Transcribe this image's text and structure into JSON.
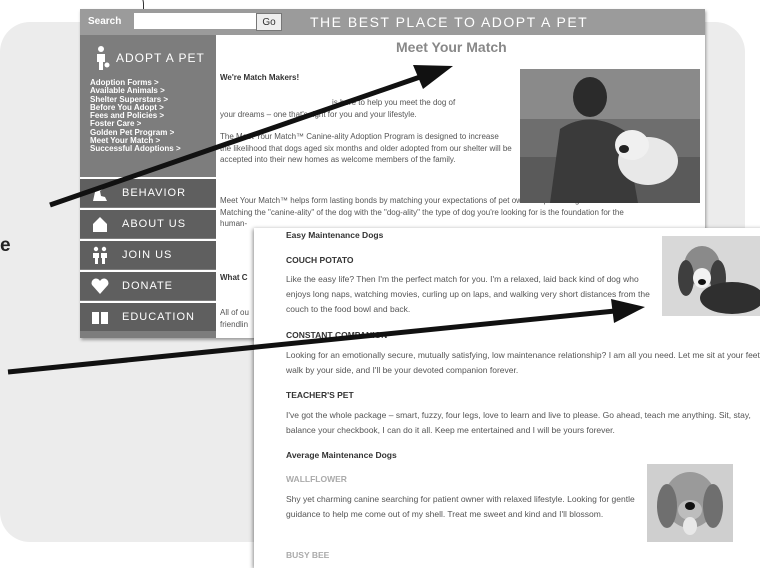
{
  "backdrop": {
    "fragment": "e"
  },
  "screen1": {
    "search_label": "Search",
    "search_value": "",
    "go_label": "Go",
    "banner": "THE BEST PLACE TO ADOPT A PET",
    "sidebar": {
      "heading": "ADOPT A PET",
      "links": [
        "Adoption Forms >",
        "Available Animals >",
        "Shelter Superstars >",
        "Before You Adopt >",
        "Fees and Policies >",
        "Foster Care >",
        "Golden Pet Program >",
        "Meet Your Match >",
        "Successful Adoptions >"
      ],
      "items": [
        {
          "label": "BEHAVIOR",
          "icon": "dog-icon"
        },
        {
          "label": "ABOUT US",
          "icon": "house-icon"
        },
        {
          "label": "JOIN US",
          "icon": "people-icon"
        },
        {
          "label": "DONATE",
          "icon": "heart-icon"
        },
        {
          "label": "EDUCATION",
          "icon": "book-icon"
        }
      ]
    },
    "title": "Meet Your Match",
    "subhead": "We're Match Makers!",
    "paragraphs": [
      "is here to help you meet the dog of",
      "your dreams – one that's right for you and your lifestyle.",
      "The Meet Your Match™ Canine-ality Adoption Program is designed to increase the likelihood that dogs aged six months and older adopted from our shelter will be accepted into their new homes as welcome members of the family.",
      "Meet Your Match™ helps form lasting bonds by matching your expectations of pet ownership to a dog's behavior. Matching the \"canine-ality\" of the dog with the \"dog-ality\" the type of dog you're looking for is the foundation for the human-"
    ],
    "what_label": "What C",
    "tail_lines": [
      "All of ou",
      "friendlin"
    ]
  },
  "screen2": {
    "section1": "Easy Maintenance Dogs",
    "couch_title": "COUCH POTATO",
    "couch_text": "Like the easy life? Then I'm the perfect match for you. I'm a relaxed, laid back kind of dog who enjoys long naps, watching movies, curling up on laps, and walking very short distances from the couch to the food bowl and back.",
    "constant_title": "CONSTANT COMPANION",
    "constant_text": "Looking for an emotionally secure, mutually satisfying, low maintenance relationship? I am all you need. Let me sit at your feet, walk by your side, and I'll be your devoted companion forever.",
    "teacher_title": "TEACHER'S PET",
    "teacher_text": "I've got the whole package – smart, fuzzy, four legs, love to learn and live to please.  Go ahead, teach me anything. Sit, stay, balance your checkbook, I can do it all. Keep me entertained and I will be yours forever.",
    "section2": "Average Maintenance Dogs",
    "wallflower_title": "WALLFLOWER",
    "wallflower_text": "Shy yet charming canine searching for patient owner with relaxed lifestyle. Looking for gentle guidance to help me come out of my shell. Treat me sweet and kind and I'll blossom.",
    "busy_title": "BUSY BEE"
  }
}
